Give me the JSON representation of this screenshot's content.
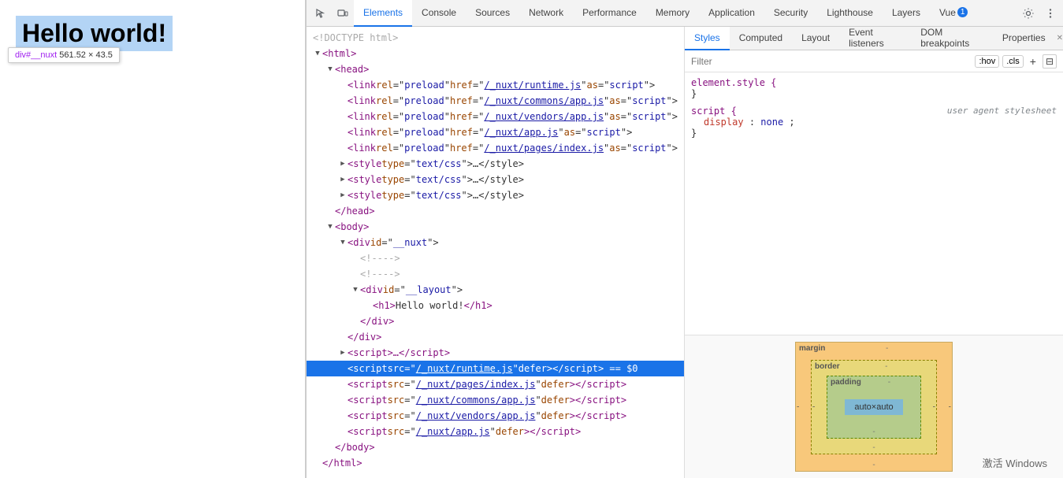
{
  "preview": {
    "title": "Hello world!",
    "tooltip": {
      "tag": "div#__nuxt",
      "dimensions": "561.52 × 43.5"
    }
  },
  "devtools": {
    "toolbar_icons": [
      "cursor-icon",
      "box-icon"
    ],
    "tabs": [
      {
        "id": "elements",
        "label": "Elements",
        "active": true
      },
      {
        "id": "console",
        "label": "Console",
        "active": false
      },
      {
        "id": "sources",
        "label": "Sources",
        "active": false
      },
      {
        "id": "network",
        "label": "Network",
        "active": false
      },
      {
        "id": "performance",
        "label": "Performance",
        "active": false
      },
      {
        "id": "memory",
        "label": "Memory",
        "active": false
      },
      {
        "id": "application",
        "label": "Application",
        "active": false
      },
      {
        "id": "security",
        "label": "Security",
        "active": false
      },
      {
        "id": "lighthouse",
        "label": "Lighthouse",
        "active": false
      },
      {
        "id": "layers",
        "label": "Layers",
        "active": false
      },
      {
        "id": "vue",
        "label": "Vue",
        "active": false
      }
    ],
    "notification_count": "1",
    "subtabs": [
      {
        "id": "styles",
        "label": "Styles",
        "active": true
      },
      {
        "id": "computed",
        "label": "Computed",
        "active": false
      },
      {
        "id": "layout",
        "label": "Layout",
        "active": false
      },
      {
        "id": "event-listeners",
        "label": "Event listeners",
        "active": false
      },
      {
        "id": "dom-breakpoints",
        "label": "DOM breakpoints",
        "active": false
      },
      {
        "id": "properties",
        "label": "Properties",
        "active": false
      }
    ],
    "filter_placeholder": "Filter",
    "filter_hov": ":hov",
    "filter_cls": ".cls",
    "html": [
      {
        "id": "line-doctype",
        "indent": 0,
        "content": "&lt;!DOCTYPE html&gt;",
        "type": "doctype",
        "selected": false
      },
      {
        "id": "line-html-open",
        "indent": 0,
        "content": "&lt;html&gt;",
        "type": "tag",
        "selected": false,
        "expandable": true,
        "expanded": true
      },
      {
        "id": "line-head-open",
        "indent": 1,
        "content": "&lt;head&gt;",
        "type": "tag",
        "selected": false,
        "expandable": true,
        "expanded": true
      },
      {
        "id": "line-link-1",
        "indent": 2,
        "content": "&lt;link rel=\"preload\" href=\"/_nuxt/runtime.js\" as=\"script\"&gt;",
        "type": "tag",
        "selected": false
      },
      {
        "id": "line-link-2",
        "indent": 2,
        "content": "&lt;link rel=\"preload\" href=\"/_nuxt/commons/app.js\" as=\"script\"&gt;",
        "type": "tag",
        "selected": false
      },
      {
        "id": "line-link-3",
        "indent": 2,
        "content": "&lt;link rel=\"preload\" href=\"/_nuxt/vendors/app.js\" as=\"script\"&gt;",
        "type": "tag",
        "selected": false
      },
      {
        "id": "line-link-4",
        "indent": 2,
        "content": "&lt;link rel=\"preload\" href=\"/_nuxt/app.js\" as=\"script\"&gt;",
        "type": "tag",
        "selected": false
      },
      {
        "id": "line-link-5",
        "indent": 2,
        "content": "&lt;link rel=\"preload\" href=\"/_nuxt/pages/index.js\" as=\"script\"&gt;",
        "type": "tag",
        "selected": false
      },
      {
        "id": "line-style-1",
        "indent": 2,
        "content": "&lt;style type=\"text/css\"&gt;…&lt;/style&gt;",
        "type": "tag",
        "selected": false,
        "expandable": true
      },
      {
        "id": "line-style-2",
        "indent": 2,
        "content": "&lt;style type=\"text/css\"&gt;…&lt;/style&gt;",
        "type": "tag",
        "selected": false,
        "expandable": true
      },
      {
        "id": "line-style-3",
        "indent": 2,
        "content": "&lt;style type=\"text/css\"&gt;…&lt;/style&gt;",
        "type": "tag",
        "selected": false,
        "expandable": true
      },
      {
        "id": "line-head-close",
        "indent": 1,
        "content": "&lt;/head&gt;",
        "type": "tag",
        "selected": false
      },
      {
        "id": "line-body-open",
        "indent": 1,
        "content": "&lt;body&gt;",
        "type": "tag",
        "selected": false,
        "expandable": true,
        "expanded": true
      },
      {
        "id": "line-div-nuxt",
        "indent": 2,
        "content": "&lt;div id=\"__nuxt\"&gt;",
        "type": "tag",
        "selected": false,
        "expandable": true,
        "expanded": true
      },
      {
        "id": "line-comment-1",
        "indent": 3,
        "content": "&lt;!----&gt;",
        "type": "comment",
        "selected": false
      },
      {
        "id": "line-comment-2",
        "indent": 3,
        "content": "&lt;!----&gt;",
        "type": "comment",
        "selected": false
      },
      {
        "id": "line-div-layout",
        "indent": 3,
        "content": "&lt;div id=\"__layout\"&gt;",
        "type": "tag",
        "selected": false,
        "expandable": true,
        "expanded": true
      },
      {
        "id": "line-h1",
        "indent": 4,
        "content": "&lt;h1&gt;Hello world!&lt;/h1&gt;",
        "type": "tag",
        "selected": false
      },
      {
        "id": "line-div-close1",
        "indent": 3,
        "content": "&lt;/div&gt;",
        "type": "tag",
        "selected": false
      },
      {
        "id": "line-div-close2",
        "indent": 2,
        "content": "&lt;/div&gt;",
        "type": "tag",
        "selected": false
      },
      {
        "id": "line-script-dots",
        "indent": 2,
        "content": "&lt;script&gt;…&lt;/script&gt;",
        "type": "tag",
        "selected": false,
        "has_dots": true
      },
      {
        "id": "line-script-runtime",
        "indent": 2,
        "content": "&lt;script src=\"/_nuxt/runtime.js\" defer&gt;&lt;/script&gt; == $0",
        "type": "tag",
        "selected": true
      },
      {
        "id": "line-script-pages",
        "indent": 2,
        "content": "&lt;script src=\"/_nuxt/pages/index.js\" defer&gt;&lt;/script&gt;",
        "type": "tag",
        "selected": false
      },
      {
        "id": "line-script-commons",
        "indent": 2,
        "content": "&lt;script src=\"/_nuxt/commons/app.js\" defer&gt;&lt;/script&gt;",
        "type": "tag",
        "selected": false
      },
      {
        "id": "line-script-vendors",
        "indent": 2,
        "content": "&lt;script src=\"/_nuxt/vendors/app.js\" defer&gt;&lt;/script&gt;",
        "type": "tag",
        "selected": false
      },
      {
        "id": "line-script-app",
        "indent": 2,
        "content": "&lt;script src=\"/_nuxt/app.js\" defer&gt;&lt;/script&gt;",
        "type": "tag",
        "selected": false
      },
      {
        "id": "line-body-close",
        "indent": 1,
        "content": "&lt;/body&gt;",
        "type": "tag",
        "selected": false
      },
      {
        "id": "line-html-close",
        "indent": 0,
        "content": "&lt;/html&gt;",
        "type": "tag",
        "selected": false
      }
    ],
    "styles": {
      "element_style": {
        "selector": "element.style {",
        "close": "}",
        "properties": []
      },
      "script_rule": {
        "selector": "script {",
        "close": "}",
        "source": "user agent stylesheet",
        "properties": [
          {
            "name": "display",
            "value": "none",
            "separator": ":"
          }
        ]
      }
    },
    "box_model": {
      "margin_label": "margin",
      "margin_top": "-",
      "margin_right": "-",
      "margin_bottom": "-",
      "margin_left": "-",
      "border_label": "border",
      "border_top": "-",
      "border_right": "-",
      "border_bottom": "-",
      "border_left": "-",
      "padding_label": "padding",
      "padding_top": "-",
      "padding_right": "-",
      "padding_bottom": "-",
      "padding_left": "-",
      "content": "auto×auto"
    }
  },
  "watermark": "激活 Windows"
}
